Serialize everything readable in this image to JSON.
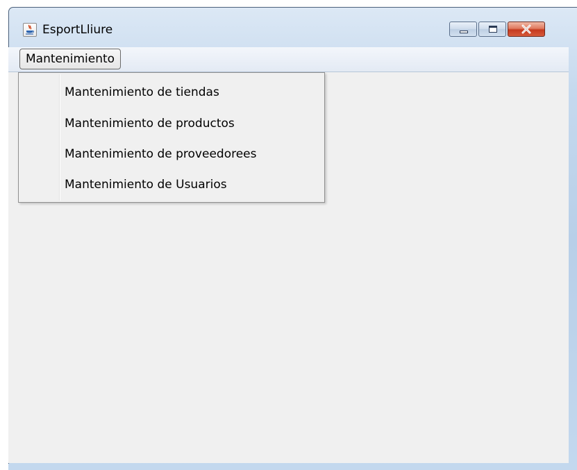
{
  "window": {
    "title": "EsportLliure",
    "app_icon": "java-cup-icon",
    "controls": {
      "minimize_icon": "minimize-icon",
      "maximize_icon": "maximize-icon",
      "close_icon": "close-icon"
    }
  },
  "menubar": {
    "items": [
      {
        "label": "Mantenimiento",
        "open": true
      }
    ]
  },
  "dropdown": {
    "items": [
      {
        "label": "Mantenimiento de tiendas"
      },
      {
        "label": "Mantenimiento de productos"
      },
      {
        "label": "Mantenimiento de proveedorees"
      },
      {
        "label": "Mantenimiento de Usuarios"
      }
    ]
  },
  "colors": {
    "client_background": "#f0f0f0",
    "close_button": "#c53a1f",
    "frame": "#b8cfe8"
  }
}
